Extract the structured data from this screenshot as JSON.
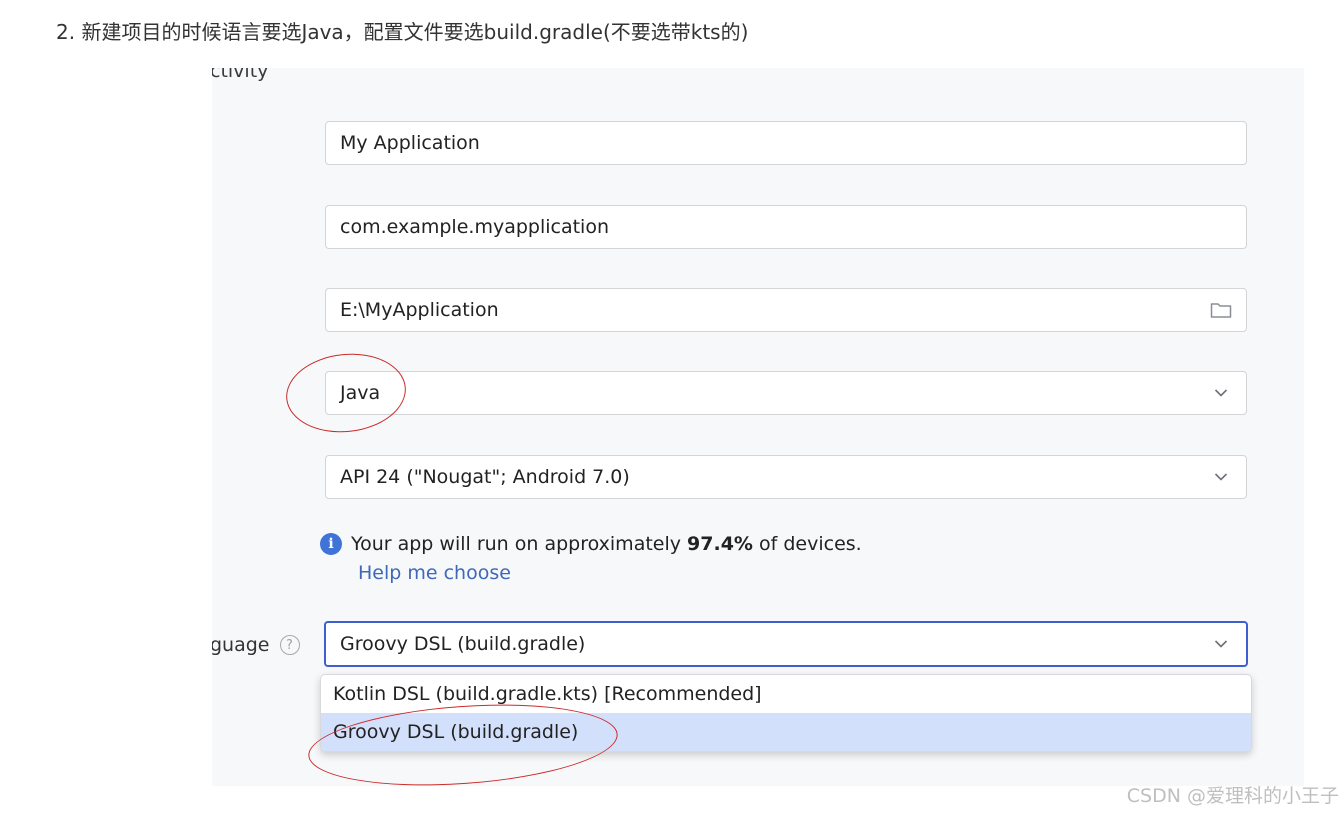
{
  "caption": "2. 新建项目的时候语言要选Java，配置文件要选build.gradle(不要选带kts的)",
  "dialog": {
    "cut_label": "ctivity",
    "name_value": "My Application",
    "package_value": "com.example.myapplication",
    "location_value": "E:\\MyApplication",
    "language_value": "Java",
    "min_sdk_value": "API 24 (\"Nougat\"; Android 7.0)",
    "info": {
      "prefix": "Your app will run on approximately ",
      "percent": "97.4%",
      "suffix": " of devices."
    },
    "help_link": "Help me choose",
    "build_config_label": "guage",
    "build_config_value": "Groovy DSL (build.gradle)",
    "build_config_options": [
      "Kotlin DSL (build.gradle.kts) [Recommended]",
      "Groovy DSL (build.gradle)"
    ]
  },
  "watermark": "CSDN @爱理科的小王子",
  "colors": {
    "annotation": "#cc2a2a",
    "focus": "#3f5fd1",
    "link": "#3e68b8",
    "selected_option": "#d3e0fb"
  },
  "icons": {
    "folder": "folder-icon",
    "dropdown": "chevron-down-icon",
    "info": "info-icon",
    "help": "question-mark-icon"
  }
}
